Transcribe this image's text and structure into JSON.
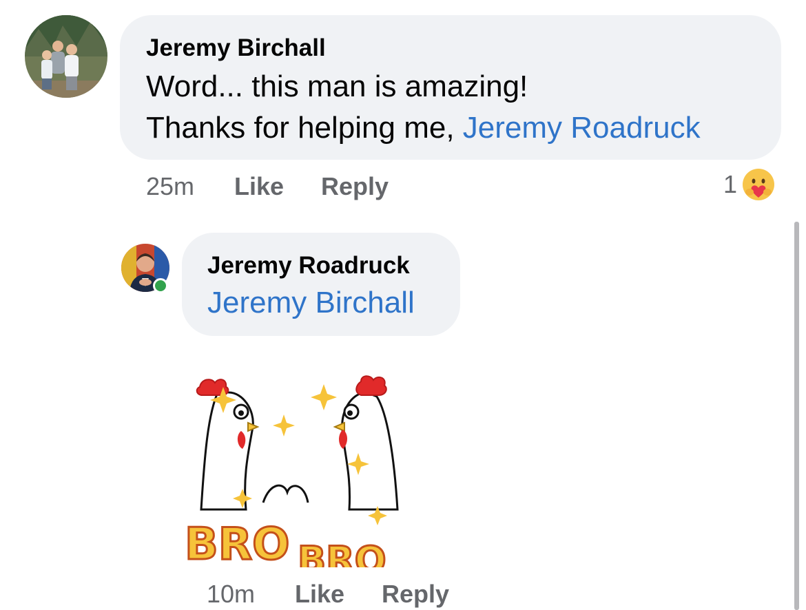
{
  "comments": [
    {
      "author": "Jeremy Birchall",
      "line1": "Word... this man is amazing!",
      "line2_prefix": "Thanks for helping me, ",
      "mention": "Jeremy Roadruck",
      "time": "25m",
      "like_label": "Like",
      "reply_label": "Reply",
      "reaction_count": "1",
      "reaction_icon": "care-emoji-icon"
    },
    {
      "author": "Jeremy Roadruck",
      "mention": "Jeremy Birchall",
      "online": true,
      "sticker_text_left": "BRO",
      "sticker_text_right": "BRO",
      "sticker": "bro-chickens-sticker",
      "time": "10m",
      "like_label": "Like",
      "reply_label": "Reply"
    }
  ],
  "colors": {
    "bubble": "#f0f2f5",
    "mention": "#2f74c9",
    "meta": "#65676b",
    "online": "#31a24c"
  }
}
